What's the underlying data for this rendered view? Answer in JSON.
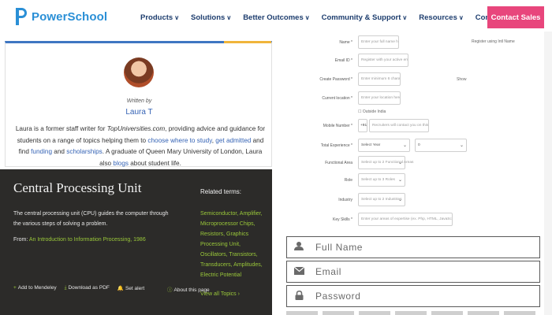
{
  "header": {
    "brand": "PowerSchool",
    "nav": [
      {
        "label": "Products"
      },
      {
        "label": "Solutions"
      },
      {
        "label": "Better Outcomes"
      },
      {
        "label": "Community & Support"
      },
      {
        "label": "Resources"
      },
      {
        "label": "Company"
      }
    ],
    "chevron": "∨",
    "contact": "Contact Sales",
    "brand_color": "#2a8fd6",
    "contact_color": "#e8467c"
  },
  "author": {
    "written_by": "Written by",
    "name": "Laura T",
    "bio_1": "Laura is a former staff writer for ",
    "bio_site": "TopUniversities.com",
    "bio_2": ", providing advice and guidance for students on a range of topics helping them to ",
    "bio_link1": "choose where to study",
    "bio_3": ", ",
    "bio_link2": "get admitted",
    "bio_4": " and find ",
    "bio_link3": "funding",
    "bio_5": " and ",
    "bio_link4": "scholarships",
    "bio_6": ". A graduate of Queen Mary University of London, Laura also ",
    "bio_link5": "blogs",
    "bio_7": " about student life."
  },
  "term": {
    "title": "Central Processing Unit",
    "description": "The central processing unit (CPU) guides the computer through the various steps of solving a problem.",
    "from_label": "From: ",
    "from_link": "An Introduction to Information Processing, 1986",
    "related_title": "Related terms:",
    "related": "Semiconductor, Amplifier, Microprocessor Chips, Resistors, Graphics Processing Unit, Oscillators, Transistors, Transducers, Amplitudes, Electric Potential",
    "view_all": "View all Topics  ›",
    "actions": [
      {
        "icon": "+",
        "label": "Add to Mendeley"
      },
      {
        "icon": "⤓",
        "label": "Download as PDF"
      },
      {
        "icon": "🔔",
        "label": "Set alert"
      }
    ],
    "about": "About this page",
    "accent_color": "#9ac83a"
  },
  "form": {
    "name_label": "Name *",
    "name_ph": "Enter your full name here",
    "email_label": "Email ID *",
    "email_ph": "Register with your active email id",
    "password_label": "Create Password *",
    "password_ph": "Enter minimum 6 characters",
    "show": "Show",
    "location_label": "Current location *",
    "location_ph": "Enter your location here",
    "outside_india": "☐ Outside India",
    "mobile_label": "Mobile Number *",
    "mobile_code": "+91",
    "mobile_ph": "Recruiters will contact you on this number",
    "exp_label": "Total Experience *",
    "exp_years": "Select Year",
    "exp_months": "0",
    "farea_label": "Functional Area",
    "farea_ph": "Select up to 2 Functional Areas",
    "role_label": "Role",
    "role_ph": "Select up to 3 Roles",
    "industry_label": "Industry",
    "industry_ph": "Select up to 2 Industries",
    "skills_label": "Key Skills *",
    "skills_ph": "Enter your areas of expertise (ex. Php, HTML, JavaScript etc)",
    "register_google": "Register using Intl Name"
  },
  "big_inputs": {
    "name": "Full Name",
    "email": "Email",
    "password": "Password"
  }
}
